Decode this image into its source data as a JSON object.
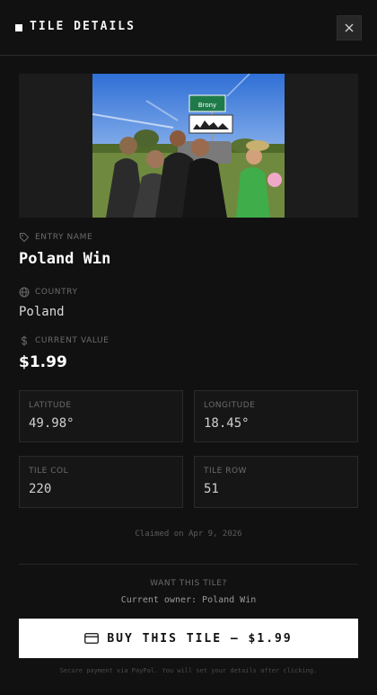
{
  "header": {
    "title": "TILE DETAILS",
    "close_icon": "close-icon"
  },
  "image": {
    "sign_text": "Brony"
  },
  "entry": {
    "label": "ENTRY NAME",
    "icon": "tag-icon",
    "value": "Poland Win"
  },
  "country": {
    "label": "COUNTRY",
    "icon": "globe-icon",
    "value": "Poland"
  },
  "current_value": {
    "label": "CURRENT VALUE",
    "icon": "dollar-icon",
    "value": "$1.99"
  },
  "stats": [
    {
      "label": "LATITUDE",
      "value": "49.98°"
    },
    {
      "label": "LONGITUDE",
      "value": "18.45°"
    },
    {
      "label": "TILE COL",
      "value": "220"
    },
    {
      "label": "TILE ROW",
      "value": "51"
    }
  ],
  "claimed": "Claimed on Apr 9, 2026",
  "purchase": {
    "want_label": "WANT THIS TILE?",
    "owner_text": "Current owner: Poland Win",
    "button_label": "BUY THIS TILE — $1.99",
    "button_icon": "credit-card-icon",
    "secure_note": "Secure payment via PayPal. You will set your details after clicking."
  },
  "colors": {
    "background": "#111111",
    "card": "#161616",
    "button": "#ffffff",
    "sign_green": "#1f7a4a"
  }
}
